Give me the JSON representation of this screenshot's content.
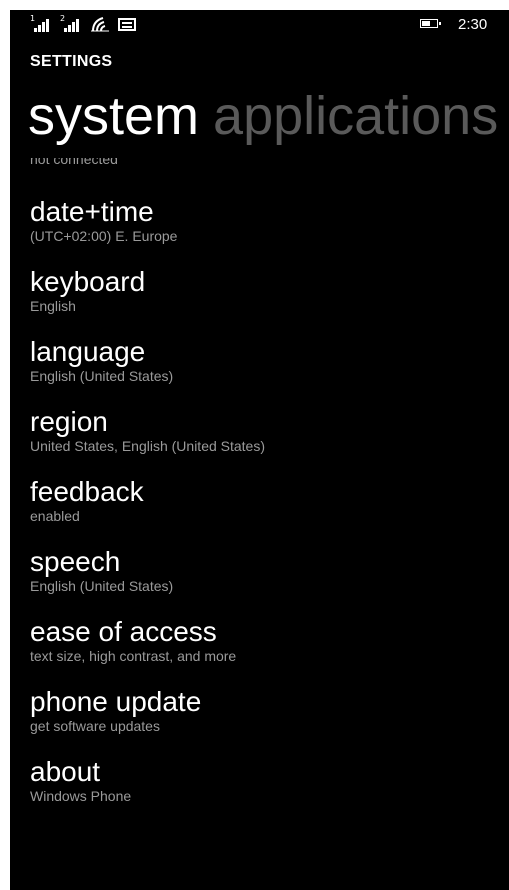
{
  "status_bar": {
    "sim1_label": "1",
    "sim2_label": "2",
    "icons": [
      "signal-sim1-icon",
      "signal-sim2-icon",
      "wifi-icon",
      "message-icon",
      "battery-icon"
    ],
    "time": "2:30"
  },
  "header": {
    "app_title": "SETTINGS",
    "pivots": [
      {
        "label": "system",
        "active": true
      },
      {
        "label": "applications",
        "active": false
      }
    ]
  },
  "list": {
    "partial_subtitle": "not connected",
    "items": [
      {
        "title": "date+time",
        "subtitle": "(UTC+02:00) E. Europe"
      },
      {
        "title": "keyboard",
        "subtitle": "English"
      },
      {
        "title": "language",
        "subtitle": "English (United States)"
      },
      {
        "title": "region",
        "subtitle": "United States, English (United States)"
      },
      {
        "title": "feedback",
        "subtitle": "enabled"
      },
      {
        "title": "speech",
        "subtitle": "English (United States)"
      },
      {
        "title": "ease of access",
        "subtitle": "text size, high contrast, and more"
      },
      {
        "title": "phone update",
        "subtitle": "get software updates"
      },
      {
        "title": "about",
        "subtitle": "Windows Phone"
      }
    ]
  },
  "colors": {
    "background": "#000000",
    "text_primary": "#ffffff",
    "text_secondary": "#9a9a9a",
    "pivot_inactive": "#5a5a5a"
  }
}
